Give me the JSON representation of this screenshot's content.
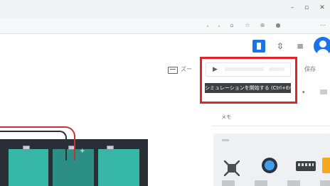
{
  "window": {
    "controls": {
      "minimize": "–",
      "maximize": "▫",
      "close": "✕"
    }
  },
  "toolbar": {
    "icons": {
      "home": "⌂",
      "star": "☆",
      "extensions": "⊕",
      "profile": "●",
      "menu": "⋯"
    }
  },
  "extensions": {
    "glyphs": {
      "puzzle": "⇳",
      "list": "≡"
    }
  },
  "app": {
    "zoom_text": "ズー",
    "right_text": "保存",
    "play_glyph": "▶",
    "tooltip": "シミュレーションを開始する (Ctrl+Enter)",
    "caret": "▾"
  },
  "sidepanel": {
    "label": "メモ"
  },
  "canvas": {
    "plus": "+"
  },
  "colors": {
    "highlight": "#e2232a",
    "accent": "#1a73e8",
    "teal": "#36b7a7",
    "wire": "#c2352f"
  }
}
